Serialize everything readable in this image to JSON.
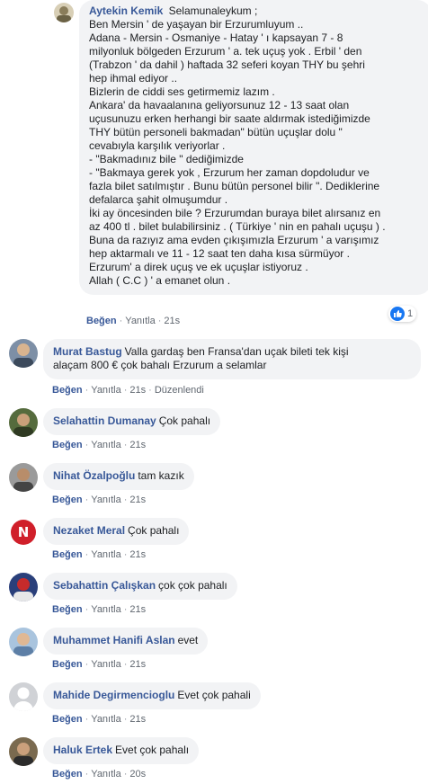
{
  "colors": {
    "link": "#385898",
    "bubble": "#f2f3f5",
    "like": "#1877f2"
  },
  "reply": {
    "author": "Aytekin Kemik",
    "lines": [
      "Selamunaleykum ;",
      "Ben Mersin ' de yaşayan bir Erzurumluyum ..",
      "Adana - Mersin - Osmaniye - Hatay ' ı kapsayan 7 - 8",
      "milyonluk bölgeden Erzurum ' a. tek uçuş yok . Erbil ' den",
      "(Trabzon ' da dahil ) haftada 32 seferi koyan THY bu şehri",
      "hep ihmal ediyor ..",
      "Bizlerin de ciddi ses getirmemiz lazım .",
      "Ankara' da havaalanına geliyorsunuz 12 - 13 saat olan",
      "uçusunuzu erken herhangi bir saate aldırmak istediğimizde",
      "THY bütün personeli bakmadan\" bütün uçuşlar dolu \"",
      "cevabıyla karşılık veriyorlar .",
      "- \"Bakmadınız bile \" dediğimizde",
      "- \"Bakmaya gerek yok , Erzurum her zaman dopdoludur ve",
      "fazla bilet satılmıştır . Bunu bütün personel bilir \". Dediklerine",
      "defalarca şahit olmuşumdur .",
      "İki ay öncesinden bile ? Erzurumdan buraya bilet alırsanız en",
      "az 400 tl . bilet bulabilirsiniz . ( Türkiye ' nin en pahalı uçuşu ) .",
      "Buna da razıyız ama evden çıkışımızla Erzurum ' a varışımız",
      "hep aktarmalı ve 11 - 12 saat ten daha kısa sürmüyor .",
      "Erzurum' a direk uçuş ve ek uçuşlar istiyoruz .",
      "Allah ( C.C ) ' a emanet olun ."
    ],
    "like_label": "Beğen",
    "reply_label": "Yanıtla",
    "time": "21s",
    "reaction_count": "1"
  },
  "comments": [
    {
      "author": "Murat Bastug",
      "text": "Valla gardaş ben Fransa'dan uçak bileti tek kişi",
      "text2": "alaçam 800 € çok bahalı Erzurum a selamlar",
      "like_label": "Beğen",
      "reply_label": "Yanıtla",
      "time": "21s",
      "edited": "Düzenlendi"
    },
    {
      "author": "Selahattin Dumanay",
      "text": "Çok pahalı",
      "like_label": "Beğen",
      "reply_label": "Yanıtla",
      "time": "21s"
    },
    {
      "author": "Nihat Özalpoğlu",
      "text": "tam kazık",
      "like_label": "Beğen",
      "reply_label": "Yanıtla",
      "time": "21s"
    },
    {
      "author": "Nezaket Meral",
      "text": "Çok pahalı",
      "like_label": "Beğen",
      "reply_label": "Yanıtla",
      "time": "21s"
    },
    {
      "author": "Sebahattin Çalışkan",
      "text": "çok çok pahalı",
      "like_label": "Beğen",
      "reply_label": "Yanıtla",
      "time": "21s"
    },
    {
      "author": "Muhammet Hanifi Aslan",
      "text": "evet",
      "like_label": "Beğen",
      "reply_label": "Yanıtla",
      "time": "21s"
    },
    {
      "author": "Mahide Degirmencioglu",
      "text": "Evet çok pahali",
      "like_label": "Beğen",
      "reply_label": "Yanıtla",
      "time": "21s"
    },
    {
      "author": "Haluk Ertek",
      "text": "Evet çok pahalı",
      "like_label": "Beğen",
      "reply_label": "Yanıtla",
      "time": "20s"
    }
  ]
}
